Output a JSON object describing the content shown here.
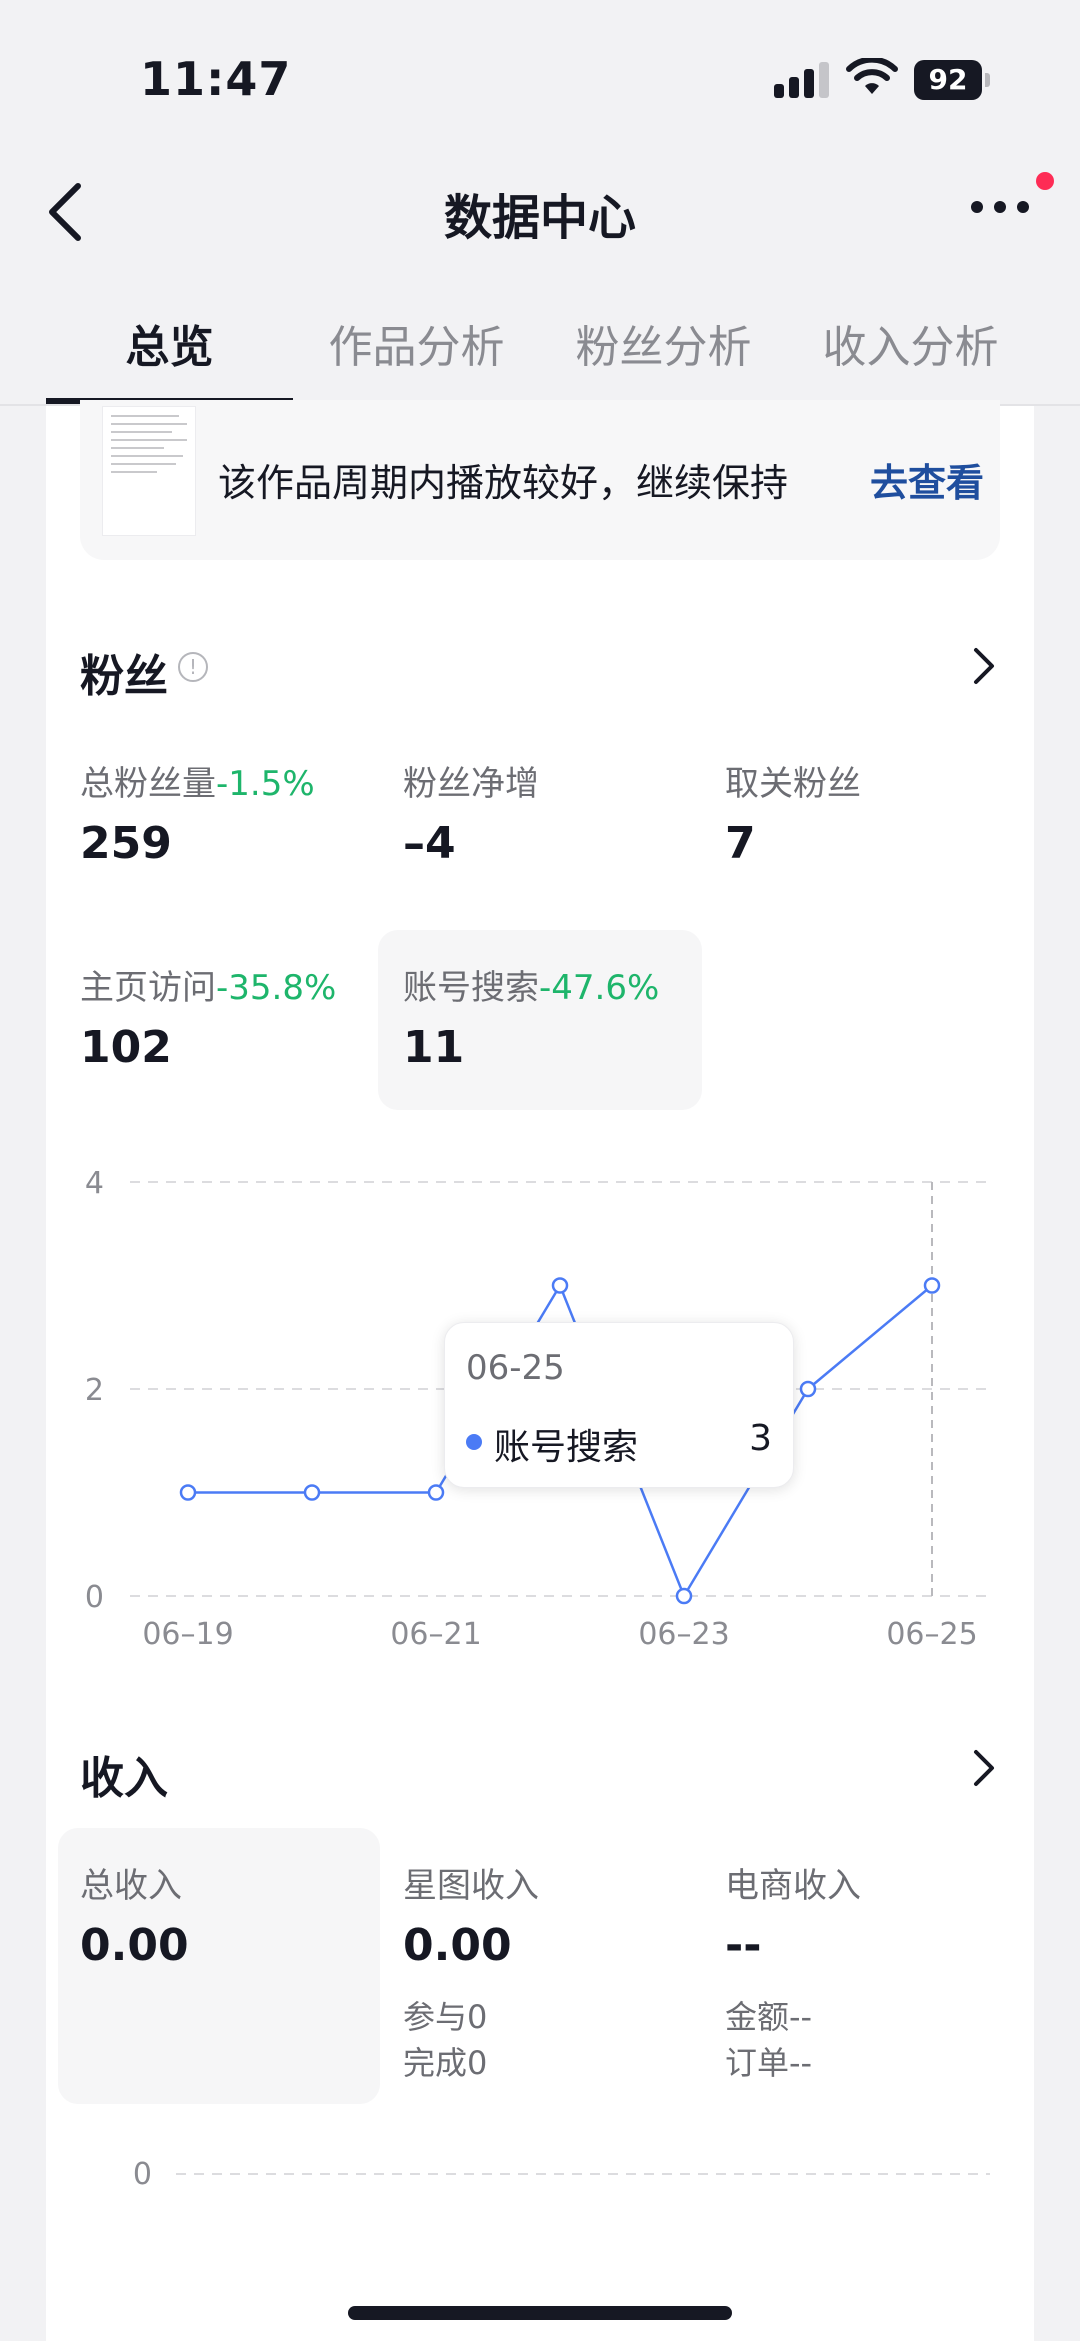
{
  "status_bar": {
    "time": "11:47",
    "battery": "92"
  },
  "nav": {
    "title": "数据中心"
  },
  "tabs": [
    {
      "label": "总览",
      "active": true
    },
    {
      "label": "作品分析",
      "active": false
    },
    {
      "label": "粉丝分析",
      "active": false
    },
    {
      "label": "收入分析",
      "active": false
    }
  ],
  "work_tip": {
    "text": "该作品周期内播放较好，继续保持",
    "link": "去查看"
  },
  "fans": {
    "title": "粉丝",
    "metrics": [
      {
        "label": "总粉丝量",
        "change": "-1.5%",
        "value": "259"
      },
      {
        "label": "粉丝净增",
        "change": "",
        "value": "–4"
      },
      {
        "label": "取关粉丝",
        "change": "",
        "value": "7"
      },
      {
        "label": "主页访问",
        "change": "-35.8%",
        "value": "102"
      },
      {
        "label": "账号搜索",
        "change": "-47.6%",
        "value": "11"
      }
    ]
  },
  "tooltip": {
    "date": "06-25",
    "series": "账号搜索",
    "value": "3"
  },
  "chart_data": {
    "type": "line",
    "x": [
      "06-19",
      "06-20",
      "06-21",
      "06-22",
      "06-23",
      "06-24",
      "06-25"
    ],
    "x_tick_labels": [
      "06–19",
      "06–21",
      "06–23",
      "06–25"
    ],
    "series": [
      {
        "name": "账号搜索",
        "values": [
          1,
          1,
          1,
          3,
          0,
          2,
          3
        ]
      }
    ],
    "y_ticks": [
      "0",
      "2",
      "4"
    ],
    "ylim": [
      0,
      4
    ],
    "grid": true,
    "line_color": "#4b7bf5"
  },
  "income": {
    "title": "收入",
    "metrics": [
      {
        "label": "总收入",
        "value": "0.00"
      },
      {
        "label": "星图收入",
        "value": "0.00",
        "sub1": "参与0",
        "sub2": "完成0"
      },
      {
        "label": "电商收入",
        "value": "--",
        "sub1": "金额--",
        "sub2": "订单--"
      }
    ],
    "chart_y_tick": "0"
  }
}
